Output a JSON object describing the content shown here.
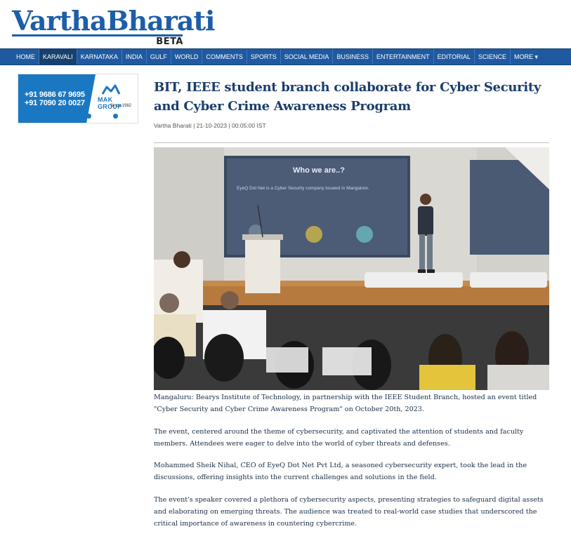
{
  "brand": {
    "name_part1": "Vartha",
    "name_part2": "Bharati",
    "tag": "BETA"
  },
  "nav": {
    "items": [
      {
        "label": "HOME"
      },
      {
        "label": "KARAVALI",
        "active": true
      },
      {
        "label": "KARNATAKA"
      },
      {
        "label": "INDIA"
      },
      {
        "label": "GULF"
      },
      {
        "label": "WORLD"
      },
      {
        "label": "COMMENTS"
      },
      {
        "label": "SPORTS"
      },
      {
        "label": "SOCIAL MEDIA"
      },
      {
        "label": "BUSINESS"
      },
      {
        "label": "ENTERTAINMENT"
      },
      {
        "label": "EDITORIAL"
      },
      {
        "label": "SCIENCE"
      },
      {
        "label": "MORE ▾"
      }
    ]
  },
  "ad": {
    "phone1": "+91 9686 67 9695",
    "phone2": "+91 7090 20 0027",
    "brand": "MAK GROUP",
    "since": "Since 1982",
    "mark_color": "#1a78c2"
  },
  "article": {
    "headline": "BIT, IEEE student branch collaborate for Cyber Security and Cyber Crime Awareness Program",
    "meta": "Vartha Bharati | 21-10-2023 | 00:05:00 IST",
    "photo": {
      "slide_title": "Who we are..?",
      "slide_text": "EyeQ Dot Net is a Cyber Security company located in Mangalore."
    },
    "paragraphs": [
      "Mangaluru: Bearys Institute of Technology, in partnership with the IEEE Student Branch, hosted an event titled \"Cyber Security and Cyber Crime Awareness Program\" on October 20th, 2023.",
      "The event, centered around the theme of cybersecurity, and captivated the attention of students and faculty members. Attendees were eager to delve into the world of cyber threats and defenses.",
      "Mohammed Sheik Nihal, CEO of EyeQ Dot Net Pvt Ltd, a seasoned cybersecurity expert, took the lead in the discussions, offering insights into the current challenges and solutions in the field.",
      "The event's speaker covered a plethora of cybersecurity aspects, presenting strategies to safeguard digital assets and elaborating on emerging threats. The audience was treated to real-world case studies that underscored the critical importance of awareness in countering cybercrime."
    ]
  },
  "colors": {
    "brand_blue": "#1d5ea8",
    "nav_bg": "#1f5aa0",
    "headline": "#1b3e6b"
  }
}
